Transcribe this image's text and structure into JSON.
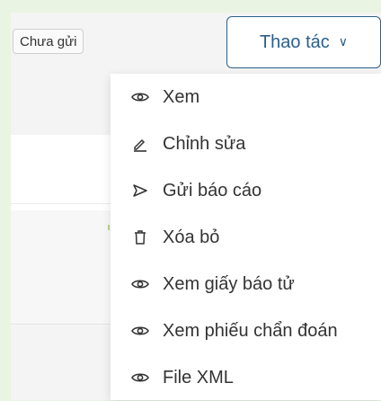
{
  "status_badge": {
    "label": "Chưa gửi"
  },
  "actions_button": {
    "label": "Thao tác",
    "chevron": "∨"
  },
  "menu": {
    "items": [
      {
        "label": "Xem",
        "icon": "eye-icon"
      },
      {
        "label": "Chỉnh sửa",
        "icon": "edit-icon"
      },
      {
        "label": "Gửi báo cáo",
        "icon": "send-icon"
      },
      {
        "label": "Xóa bỏ",
        "icon": "trash-icon"
      },
      {
        "label": "Xem giấy báo tử",
        "icon": "eye-icon"
      },
      {
        "label": "Xem phiếu chẩn đoán",
        "icon": "eye-icon"
      },
      {
        "label": "File XML",
        "icon": "eye-icon"
      }
    ]
  },
  "colors": {
    "page_background": "#eaf4e2",
    "accent": "#2a5f8a"
  }
}
